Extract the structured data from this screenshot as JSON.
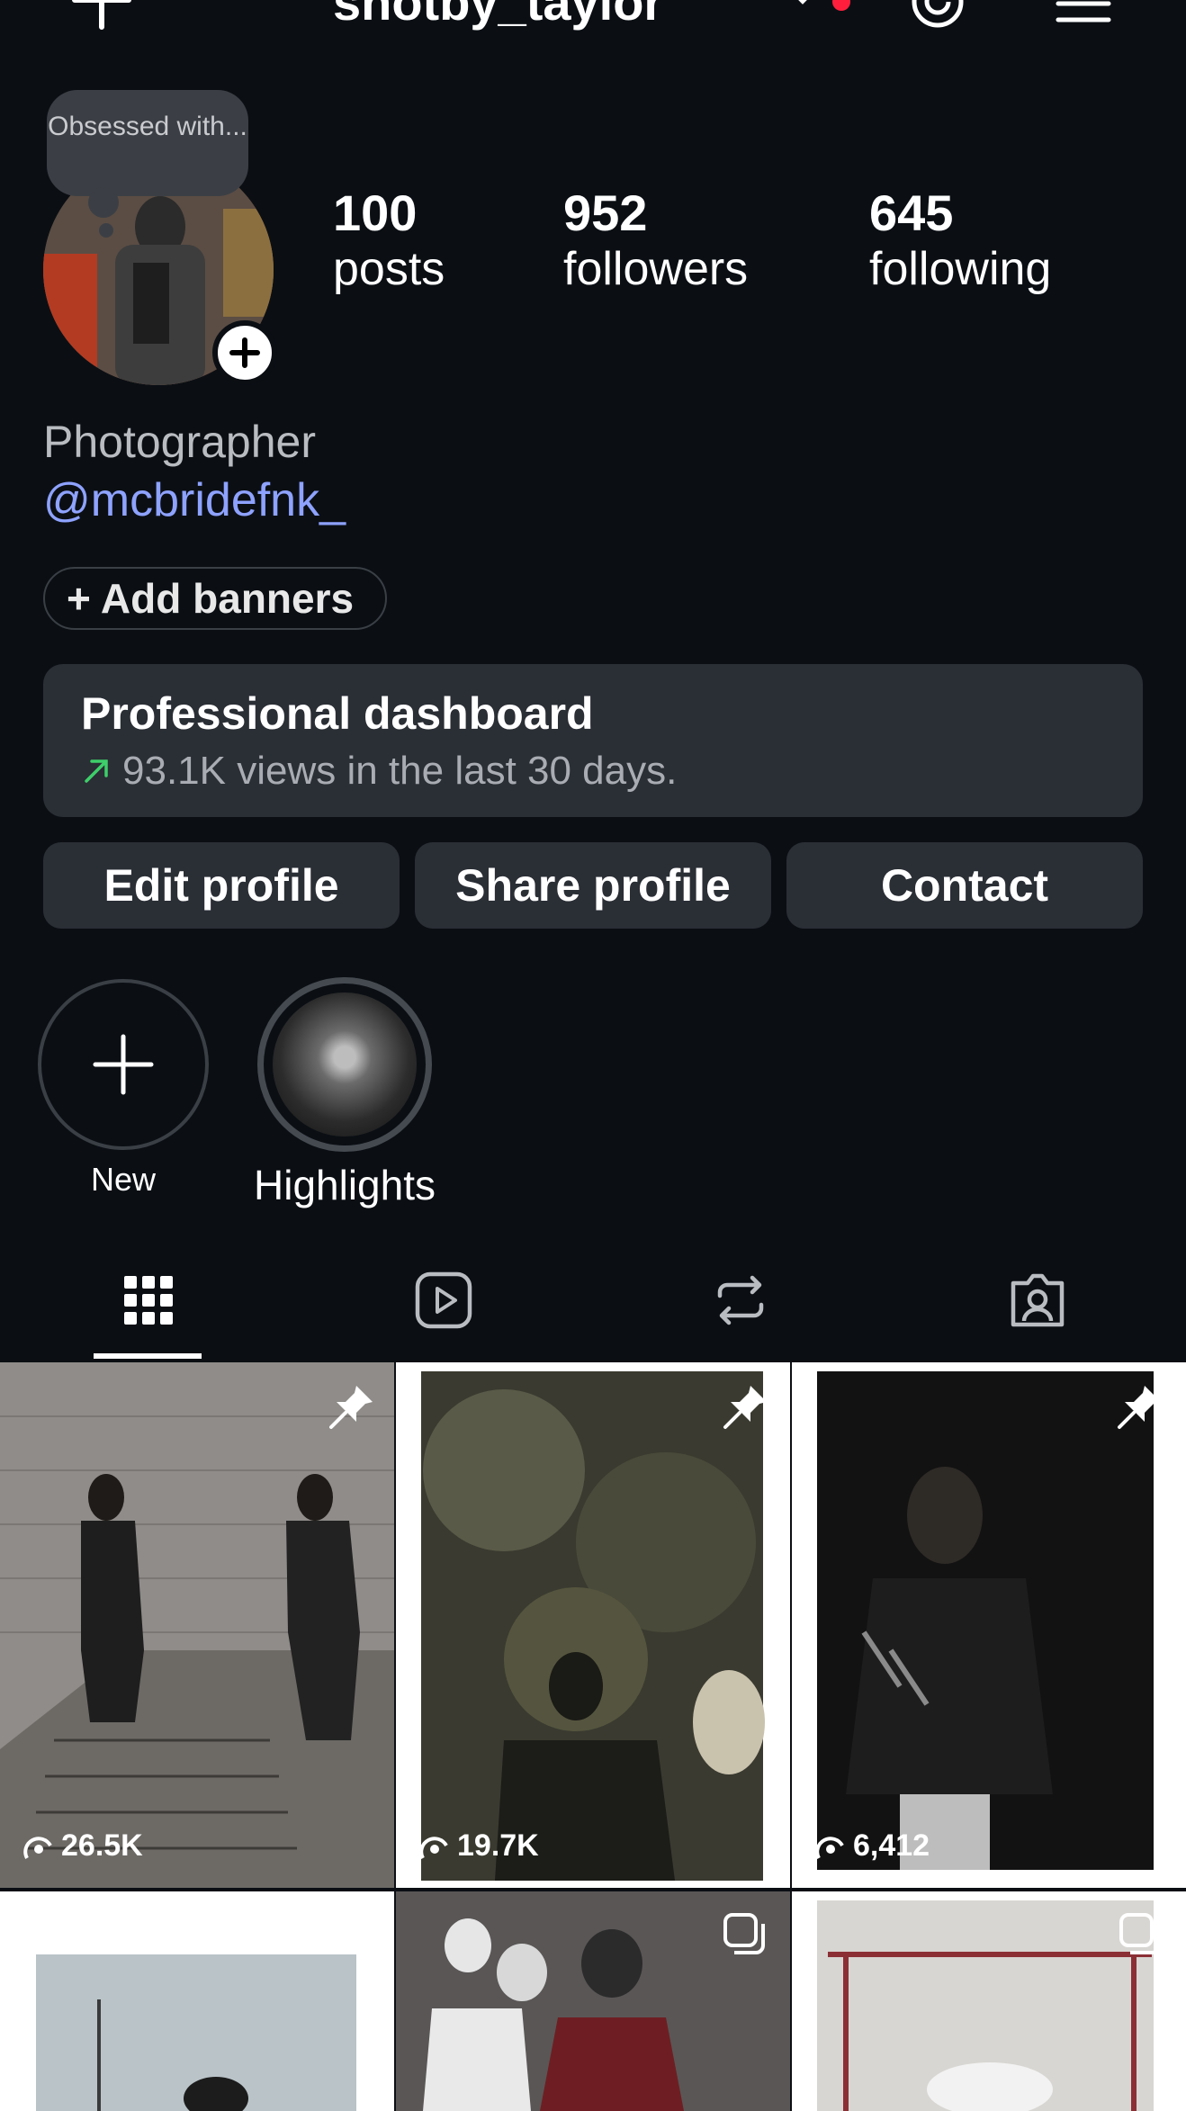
{
  "header": {
    "username": "shotby_taylor"
  },
  "note": {
    "text": "Obsessed with..."
  },
  "stats": [
    {
      "num": "100",
      "label": "posts"
    },
    {
      "num": "952",
      "label": "followers"
    },
    {
      "num": "645",
      "label": "following"
    }
  ],
  "bio": {
    "category": "Photographer",
    "mention": "@mcbridefnk_"
  },
  "banners": {
    "label": "+ Add banners"
  },
  "dashboard": {
    "title": "Professional dashboard",
    "subtitle": "93.1K views in the last 30 days."
  },
  "actions": {
    "edit": "Edit profile",
    "share": "Share profile",
    "contact": "Contact"
  },
  "highlights": [
    {
      "label": "New"
    },
    {
      "label": "Highlights"
    }
  ],
  "tabs": [
    "grid-icon",
    "reels-icon",
    "reposts-icon",
    "tagged-icon"
  ],
  "posts": [
    {
      "views": "26.5K",
      "pinned": true
    },
    {
      "views": "19.7K",
      "pinned": true
    },
    {
      "views": "6,412",
      "pinned": true
    },
    {
      "views": "",
      "pinned": false
    },
    {
      "views": "",
      "pinned": false
    },
    {
      "views": "",
      "pinned": false
    }
  ],
  "colors": {
    "background": "#0b0f14",
    "card": "#2a2e35",
    "link": "#8ea2ff",
    "trend": "#3ecf6a",
    "notification": "#ff1f3d"
  }
}
